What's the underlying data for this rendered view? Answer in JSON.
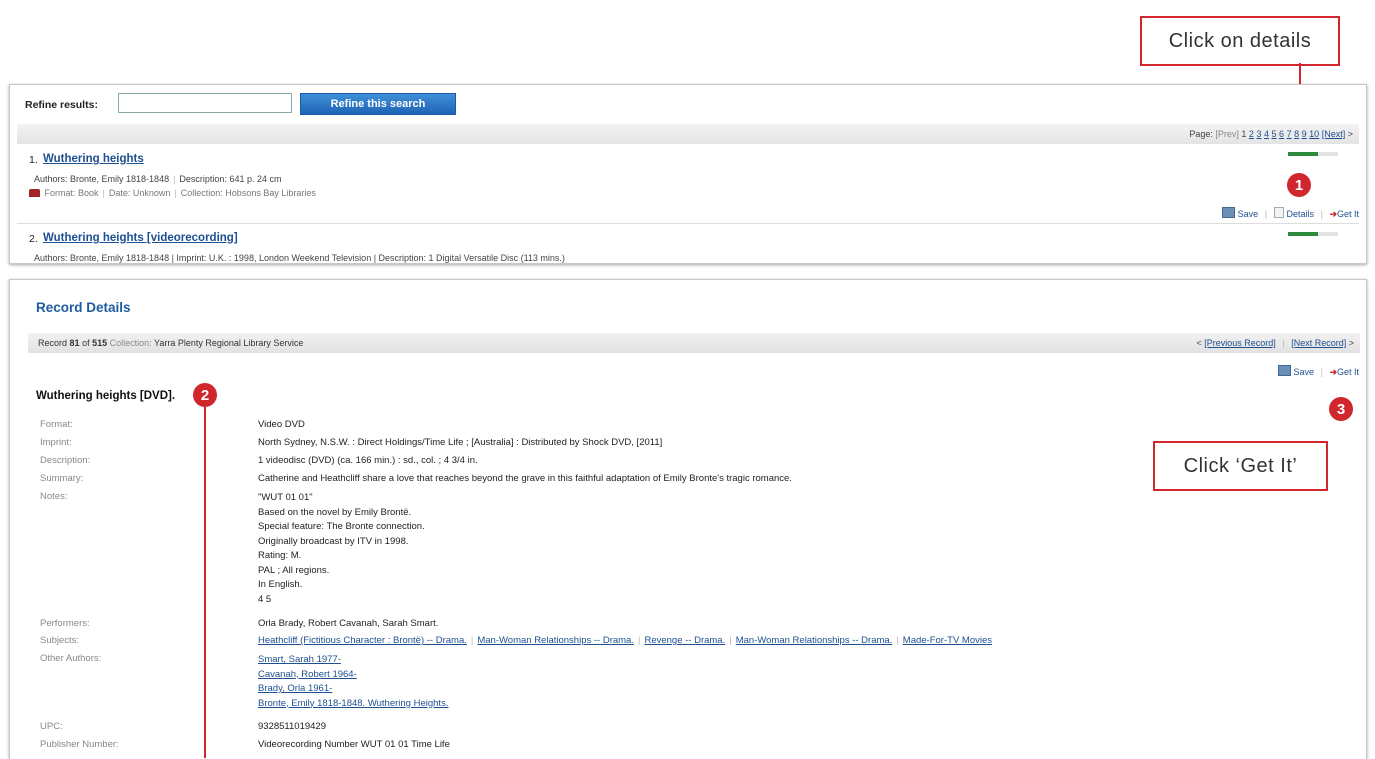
{
  "callouts": {
    "details": "Click on details",
    "getit": "Click ‘Get It’",
    "badge1": "1",
    "badge2": "2",
    "badge3": "3"
  },
  "search_results": {
    "refine_label": "Refine results:",
    "refine_input_value": "",
    "refine_button": "Refine this search",
    "pager": {
      "label": "Page:",
      "prev": "[Prev]",
      "current": "1",
      "pages": [
        "2",
        "3",
        "4",
        "5",
        "6",
        "7",
        "8",
        "9",
        "10"
      ],
      "next": "[Next]",
      "next_arrow": ">"
    },
    "results": [
      {
        "number": "1.",
        "title": "Wuthering heights",
        "authors": "Authors: Bronte, Emily 1818-1848",
        "description": "Description: 641 p. 24 cm",
        "format": "Format: Book",
        "date": "Date: Unknown",
        "collection": "Collection: Hobsons Bay Libraries",
        "rating_fraction": 0.6
      },
      {
        "number": "2.",
        "title": "Wuthering heights [videorecording]",
        "details_line": "Authors: Bronte, Emily 1818-1848 | Imprint: U.K. : 1998, London Weekend Television | Description: 1 Digital Versatile Disc (113 mins.)",
        "rating_fraction": 0.6
      }
    ],
    "actions": {
      "save": "Save",
      "details": "Details",
      "getit": "Get It"
    }
  },
  "record": {
    "heading": "Record Details",
    "record_prefix": "Record",
    "record_num": "81",
    "record_of": "of",
    "record_total": "515",
    "collection_label": "Collection:",
    "collection_name": "Yarra Plenty Regional Library Service",
    "prev_record": "[Previous Record]",
    "next_record": "[Next Record]",
    "prev_arrow": "<",
    "next_arrow": ">",
    "save": "Save",
    "getit": "Get It",
    "title": "Wuthering heights [DVD].",
    "fields": {
      "format_label": "Format:",
      "format": "Video DVD",
      "imprint_label": "Imprint:",
      "imprint": "North Sydney, N.S.W. : Direct Holdings/Time Life ; [Australia] : Distributed by Shock DVD, [2011]",
      "description_label": "Description:",
      "description": "1 videodisc (DVD) (ca. 166 min.) : sd., col. ; 4 3/4 in.",
      "summary_label": "Summary:",
      "summary": "Catherine and Heathcliff share a love that reaches beyond the grave in this faithful adaptation of Emily Bronte's tragic romance.",
      "notes_label": "Notes:",
      "notes": [
        "\"WUT 01 01\"",
        "Based on the novel by Emily Brontë.",
        "Special feature: The Bronte connection.",
        "Originally broadcast by ITV in 1998.",
        "Rating: M.",
        "PAL ; All regions.",
        "In English.",
        "4 5"
      ],
      "performers_label": "Performers:",
      "performers": "Orla Brady, Robert Cavanah, Sarah Smart.",
      "subjects_label": "Subjects:",
      "subjects": [
        "Heathcliff (Fictitious Character : Brontë) -- Drama.",
        "Man-Woman Relationships -- Drama.",
        "Revenge -- Drama.",
        "Man-Woman Relationships -- Drama.",
        "Made-For-TV Movies"
      ],
      "other_authors_label": "Other Authors:",
      "other_authors": [
        "Smart, Sarah 1977-",
        "Cavanah, Robert 1964-",
        "Brady, Orla 1961-",
        "Bronte, Emily 1818-1848. Wuthering Heights."
      ],
      "upc_label": "UPC:",
      "upc": "9328511019429",
      "publisher_label": "Publisher Number:",
      "publisher": "Videorecording Number WUT 01 01 Time Life"
    }
  },
  "colors": {
    "accent": "#d0262e",
    "link": "#1d4f91",
    "button": "#2b74c6",
    "rating": "#2c8a3f"
  }
}
